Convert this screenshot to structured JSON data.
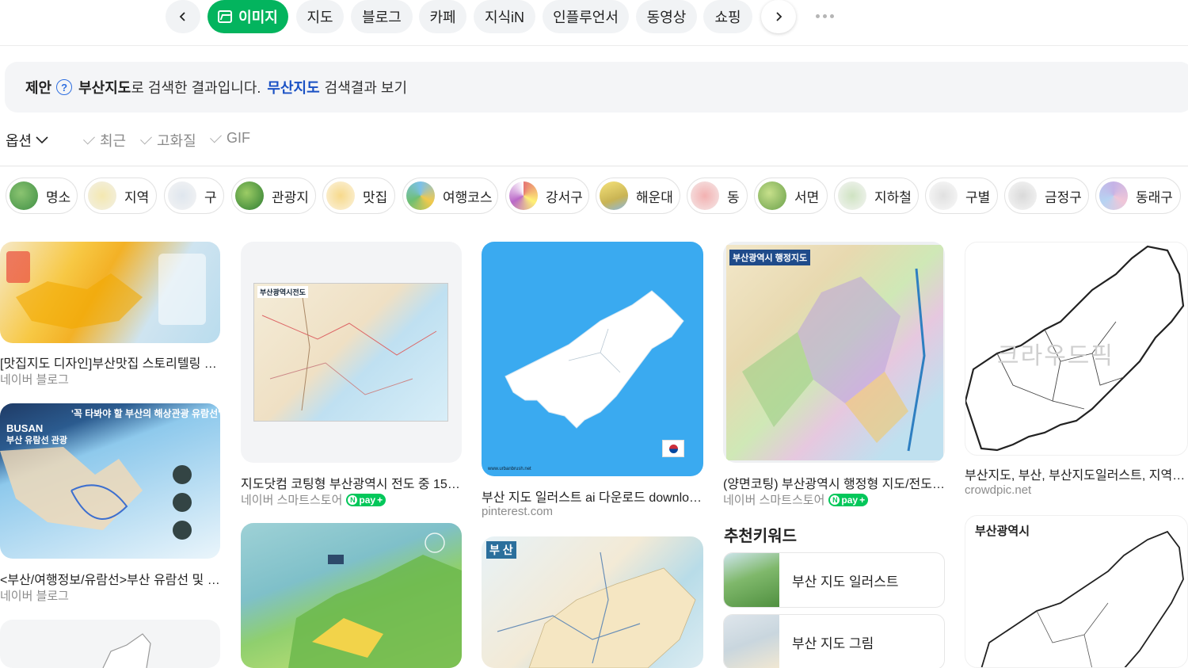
{
  "tabs": {
    "items": [
      "이미지",
      "지도",
      "블로그",
      "카페",
      "지식iN",
      "인플루언서",
      "동영상",
      "쇼핑"
    ],
    "active": "이미지"
  },
  "suggestion": {
    "label": "제안",
    "keyword": "부산지도",
    "text": "로 검색한 결과입니다.",
    "link": "무산지도",
    "link_tail": "검색결과 보기"
  },
  "options": {
    "label": "옵션",
    "filters": [
      "최근",
      "고화질",
      "GIF"
    ]
  },
  "chips": [
    "명소",
    "지역",
    "구",
    "관광지",
    "맛집",
    "여행코스",
    "강서구",
    "해운대",
    "동",
    "서면",
    "지하철",
    "구별",
    "금정구",
    "동래구"
  ],
  "results": {
    "col1": [
      {
        "caption": "[맛집지도 디자인]부산맛집 스토리텔링 지도",
        "source": "네이버 블로그"
      },
      {
        "caption": "<부산/여행정보/유람선>부산 유람선 및 코...",
        "source": "네이버 블로그",
        "image_title": "'꼭 타봐야 할 부산의 해상관광 유람선'",
        "image_badge": "BUSAN",
        "image_badge2": "부산 유람선 관광"
      }
    ],
    "col2": [
      {
        "caption": "지도닷컴 코팅형 부산광역시 전도 중 150 x...",
        "source": "네이버 스마트스토어",
        "npay": true,
        "image_label": "부산광역시전도"
      }
    ],
    "col3": [
      {
        "caption": "부산 지도 일러스트 ai 다운로드 downloa...",
        "source": "pinterest.com",
        "image_credit": "www.urbanbrush.net"
      },
      {
        "image_label": "부 산"
      }
    ],
    "col4": [
      {
        "caption": "(양면코팅) 부산광역시 행정형 지도/전도 - ...",
        "source": "네이버 스마트스토어",
        "npay": true,
        "image_label": "부산광역시 행정지도"
      }
    ],
    "col5": [
      {
        "caption": "부산지도, 부산, 부산지도일러스트, 지역지...",
        "source": "crowdpic.net",
        "watermark": "크라우드픽"
      },
      {
        "image_label": "부산광역시"
      }
    ]
  },
  "recommend": {
    "title": "추천키워드",
    "items": [
      "부산 지도 일러스트",
      "부산 지도 그림"
    ]
  },
  "npay_label": "pay",
  "colors": {
    "accent": "#03b45e",
    "link": "#1a51c4",
    "npay": "#03c75a"
  }
}
